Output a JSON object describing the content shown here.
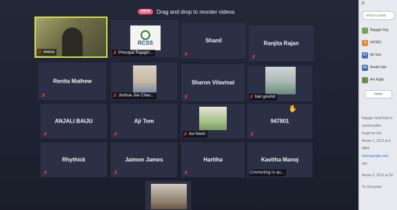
{
  "banner": {
    "badge": "NEW",
    "text": "Drag and drop to reorder videos"
  },
  "tiles": [
    {
      "name": "veeva"
    },
    {
      "name": "Principal Rajagiri..."
    },
    {
      "name": "Shanil"
    },
    {
      "name": "Ranjita Rajan"
    },
    {
      "name": "Renita Mathew"
    },
    {
      "name": "Joshua Joe Chau..."
    },
    {
      "name": "Sharon Vilavinal"
    },
    {
      "name": "hari govind"
    },
    {
      "name": "ANJALI BAIJU"
    },
    {
      "name": "Aji Tom"
    },
    {
      "name": "Avi Nash"
    },
    {
      "name": "947801"
    },
    {
      "name": "Rhythick"
    },
    {
      "name": "Jaimon James"
    },
    {
      "name": "Haritha"
    },
    {
      "name": "Kavitha Manoj",
      "status": "Connecting to au..."
    }
  ],
  "logo": {
    "text": "RCSS"
  },
  "panel": {
    "header": "P",
    "search_placeholder": "Find a partic",
    "participants": [
      {
        "initials": "",
        "label": "Rajagiri Raj",
        "color": "#7aa35a"
      },
      {
        "initials": "9",
        "label": "947801",
        "color": "#e08a2b"
      },
      {
        "initials": "AT",
        "label": "Aji Tom",
        "color": "#3b6fb6"
      },
      {
        "initials": "AE",
        "label": "Anakh Ajin",
        "color": "#3b6fb6"
      },
      {
        "initials": "",
        "label": "Ani Rajib",
        "color": "#6c8f4a"
      }
    ],
    "more_label": "more",
    "chat_lines": [
      "Rajagiri Ian(Host) to",
      "sessions(the",
      "forget for the",
      "Aimee 1, 2012 at 6",
      "MBA",
      "meet.google.com/..."
    ],
    "link_text": "meet.google.com",
    "link_suffix": "ask",
    "footer_time": "Aimee 2, 2012 at 20",
    "to_label": "To: Everyone"
  }
}
